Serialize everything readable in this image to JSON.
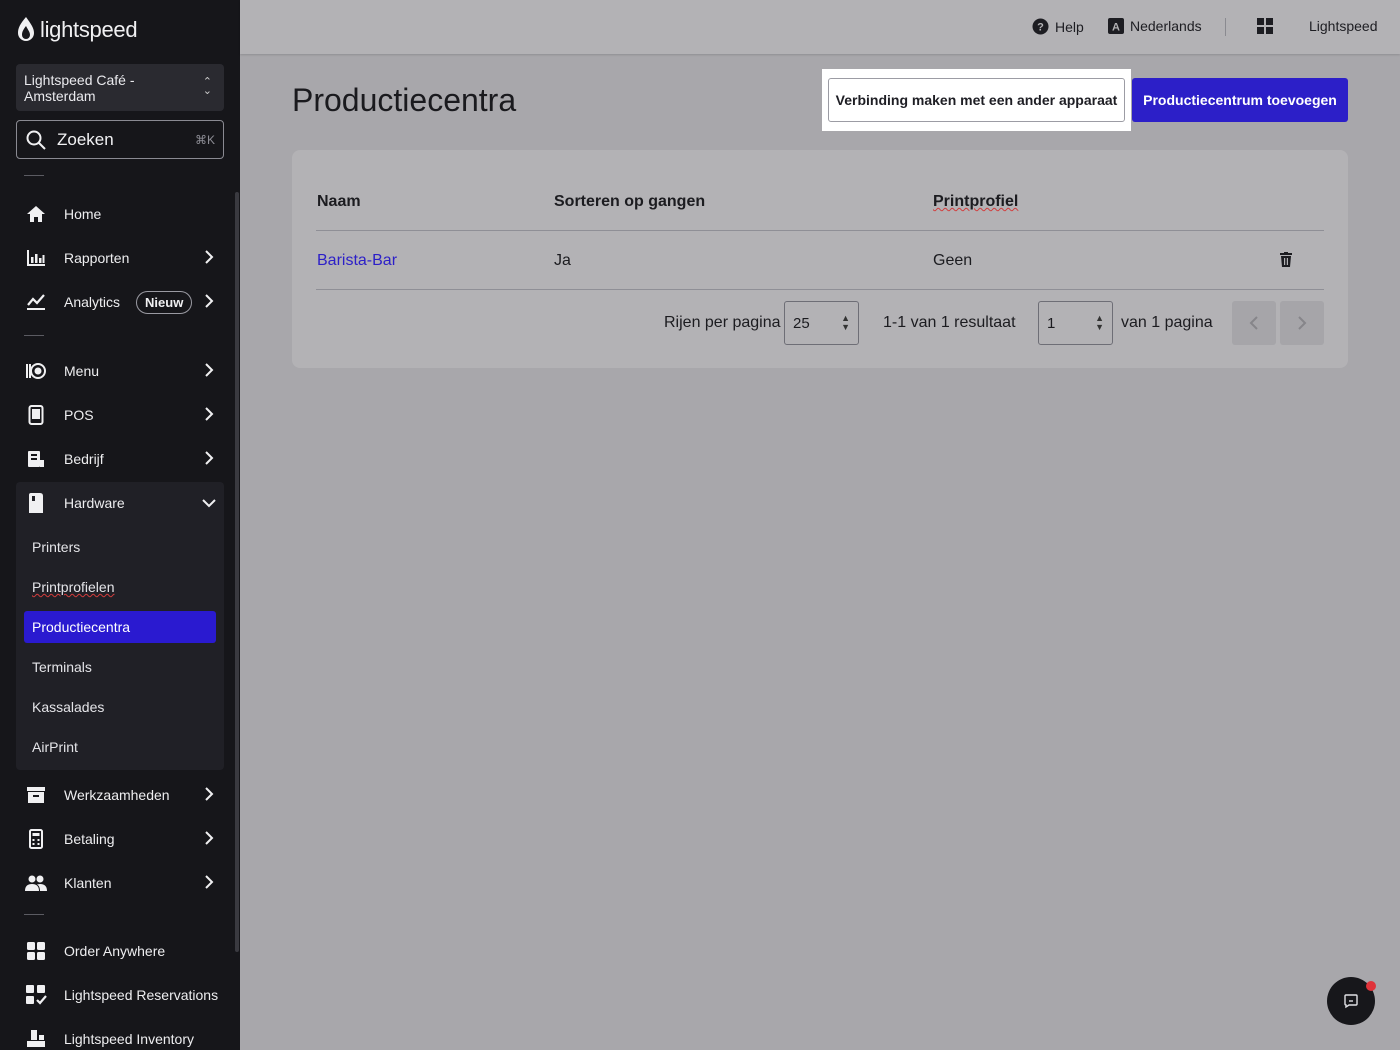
{
  "sidebar": {
    "logo": "lightspeed",
    "venue": "Lightspeed Café - Amsterdam",
    "search": {
      "label": "Zoeken",
      "shortcut": "⌘K"
    },
    "items": {
      "home": "Home",
      "rapporten": "Rapporten",
      "analytics": "Analytics",
      "analytics_badge": "Nieuw",
      "menu": "Menu",
      "pos": "POS",
      "bedrijf": "Bedrijf",
      "hardware": "Hardware",
      "werkzaamheden": "Werkzaamheden",
      "betaling": "Betaling",
      "klanten": "Klanten",
      "order_anywhere": "Order Anywhere",
      "reservations": "Lightspeed Reservations",
      "inventory": "Lightspeed Inventory"
    },
    "hardware_sub": {
      "printers": "Printers",
      "printprofielen": "Printprofielen",
      "productiecentra": "Productiecentra",
      "terminals": "Terminals",
      "kassalades": "Kassalades",
      "airprint": "AirPrint"
    }
  },
  "topbar": {
    "help": "Help",
    "language": "Nederlands",
    "account": "Lightspeed"
  },
  "main": {
    "title": "Productiecentra",
    "connect_button": "Verbinding maken met een ander apparaat",
    "add_button": "Productiecentrum toevoegen",
    "table": {
      "headers": {
        "naam": "Naam",
        "sorteren": "Sorteren op gangen",
        "printprofiel": "Printprofiel"
      },
      "rows": [
        {
          "naam": "Barista-Bar",
          "sorteren": "Ja",
          "printprofiel": "Geen"
        }
      ]
    },
    "pagination": {
      "rows_label": "Rijen per pagina",
      "rows_value": "25",
      "result": "1-1 van 1 resultaat",
      "page_value": "1",
      "page_of": "van 1 pagina"
    }
  },
  "colors": {
    "accent": "#2c1fc8",
    "sidebar_bg": "#16161a",
    "overlay_bg": "#a8a7ab",
    "notification": "#e0333a"
  }
}
